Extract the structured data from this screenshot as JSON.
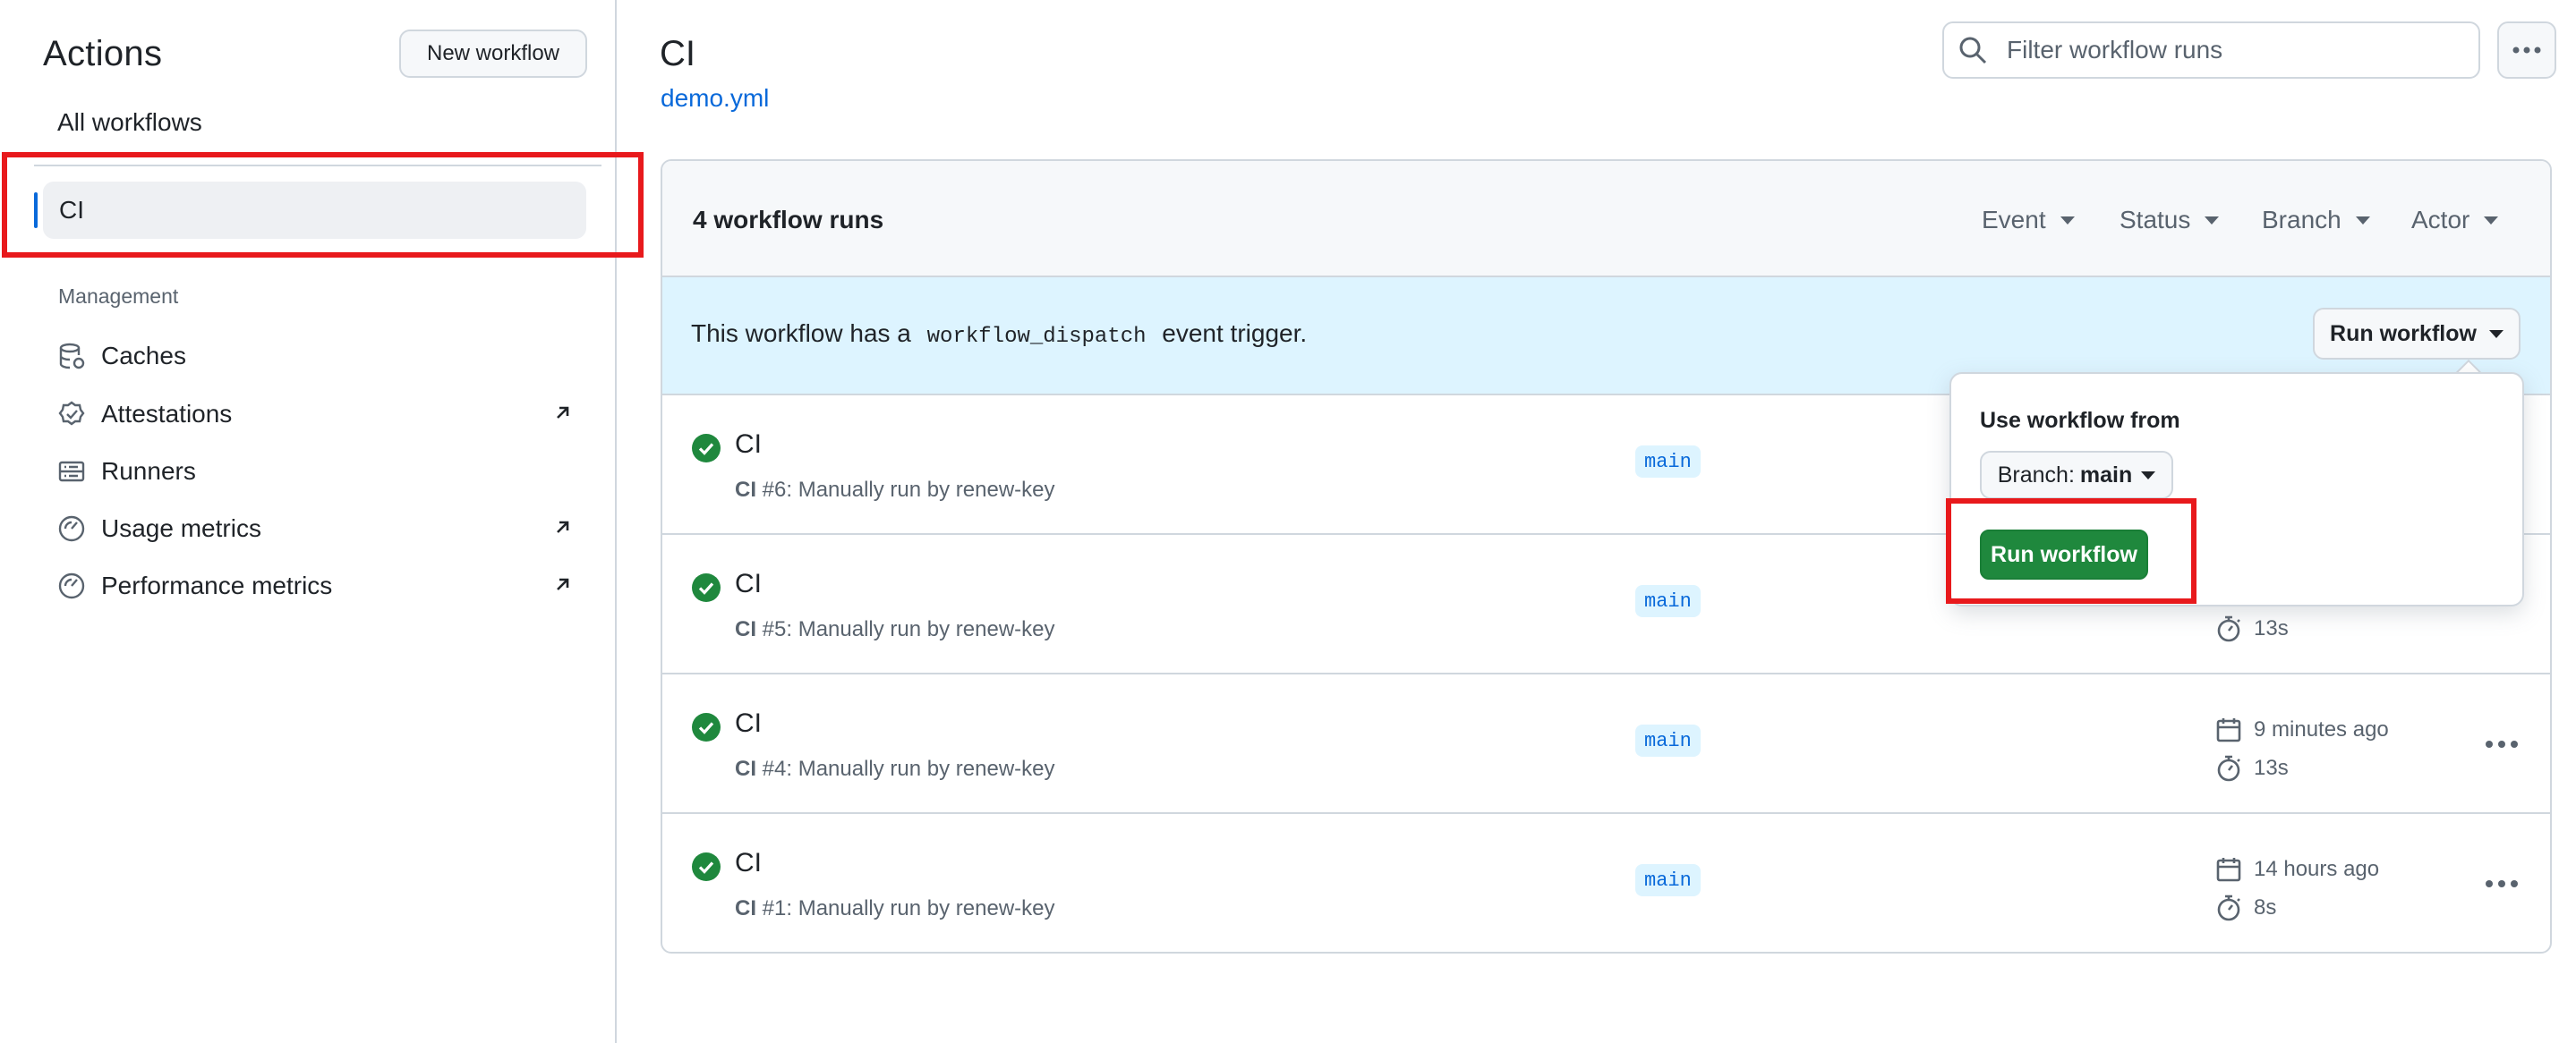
{
  "sidebar": {
    "title": "Actions",
    "new_workflow_label": "New workflow",
    "all_workflows_label": "All workflows",
    "selected_workflow": "CI",
    "section_label": "Management",
    "items": [
      {
        "label": "Caches",
        "icon": "database-icon",
        "external": false
      },
      {
        "label": "Attestations",
        "icon": "verified-icon",
        "external": true
      },
      {
        "label": "Runners",
        "icon": "server-icon",
        "external": false
      },
      {
        "label": "Usage metrics",
        "icon": "meter-icon",
        "external": true
      },
      {
        "label": "Performance metrics",
        "icon": "meter-icon",
        "external": true
      }
    ]
  },
  "header": {
    "title": "CI",
    "file_link": "demo.yml",
    "filter_placeholder": "Filter workflow runs"
  },
  "runs": {
    "count_label": "4 workflow runs",
    "filters": [
      "Event",
      "Status",
      "Branch",
      "Actor"
    ],
    "dispatch_prefix": "This workflow has a",
    "dispatch_code": "workflow_dispatch",
    "dispatch_suffix": "event trigger.",
    "run_workflow_label": "Run workflow",
    "rows": [
      {
        "title": "CI",
        "workflow": "CI",
        "detail": "#6: Manually run by renew-key",
        "branch": "main",
        "time": "",
        "duration": ""
      },
      {
        "title": "CI",
        "workflow": "CI",
        "detail": "#5: Manually run by renew-key",
        "branch": "main",
        "time": "",
        "duration": "13s"
      },
      {
        "title": "CI",
        "workflow": "CI",
        "detail": "#4: Manually run by renew-key",
        "branch": "main",
        "time": "9 minutes ago",
        "duration": "13s"
      },
      {
        "title": "CI",
        "workflow": "CI",
        "detail": "#1: Manually run by renew-key",
        "branch": "main",
        "time": "14 hours ago",
        "duration": "8s"
      }
    ]
  },
  "dropdown": {
    "title": "Use workflow from",
    "branch_prefix": "Branch:",
    "branch_value": "main",
    "run_button_label": "Run workflow"
  },
  "colors": {
    "accent": "#0969da",
    "success": "#1f883d",
    "highlight": "#e8191c"
  }
}
